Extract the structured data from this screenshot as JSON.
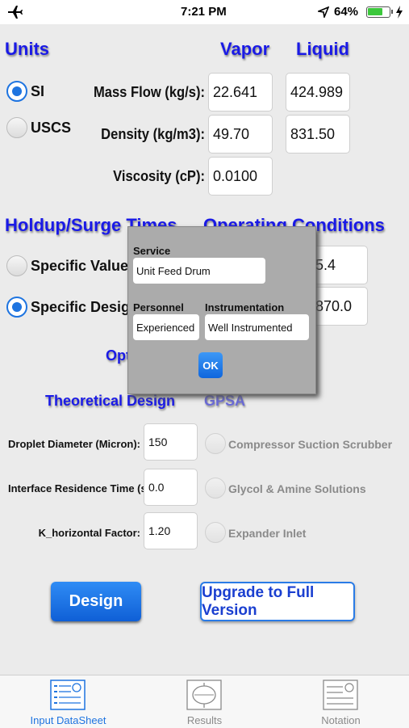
{
  "status": {
    "time": "7:21 PM",
    "battery": "64%"
  },
  "units": {
    "title": "Units",
    "si": "SI",
    "uscs": "USCS"
  },
  "flow": {
    "vapor_title": "Vapor",
    "liquid_title": "Liquid",
    "mass_flow_label": "Mass Flow (kg/s):",
    "density_label": "Density (kg/m3):",
    "viscosity_label": "Viscosity (cP):",
    "vapor_mass_flow": "22.641",
    "liquid_mass_flow": "424.989",
    "vapor_density": "49.70",
    "liquid_density": "831.50",
    "vapor_viscosity": "0.0100"
  },
  "holdup": {
    "title": "Holdup/Surge Times",
    "specific_values": "Specific Values",
    "specific_design": "Specific Design"
  },
  "operating": {
    "title": "Operating Conditions",
    "value1": "5.4",
    "value2": "870.0"
  },
  "options_title": "Opt",
  "theoretical": {
    "title": "Theoretical Design",
    "droplet_label": "Droplet Diameter (Micron):",
    "droplet_value": "150",
    "residence_label": "Interface Residence Time (s):",
    "residence_value": "0.0",
    "k_label": "K_horizontal Factor:",
    "k_value": "1.20"
  },
  "gpsa": {
    "title": "GPSA",
    "opt1": "Compressor Suction Scrubber",
    "opt2": "Glycol & Amine Solutions",
    "opt3": "Expander Inlet"
  },
  "buttons": {
    "design": "Design",
    "upgrade": "Upgrade to Full Version"
  },
  "dialog": {
    "service_label": "Service",
    "service_value": "Unit Feed Drum",
    "personnel_label": "Personnel",
    "personnel_value": "Experienced",
    "instrumentation_label": "Instrumentation",
    "instrumentation_value": "Well Instrumented",
    "ok": "OK"
  },
  "tabs": [
    {
      "label": "Input DataSheet",
      "icon": "datasheet-icon",
      "active": true
    },
    {
      "label": "Results",
      "icon": "drum-icon",
      "active": false
    },
    {
      "label": "Notation",
      "icon": "notation-icon",
      "active": false
    }
  ],
  "colors": {
    "header_blue": "#1a1ae6",
    "accent": "#1e74e0",
    "background": "#ebebeb"
  }
}
